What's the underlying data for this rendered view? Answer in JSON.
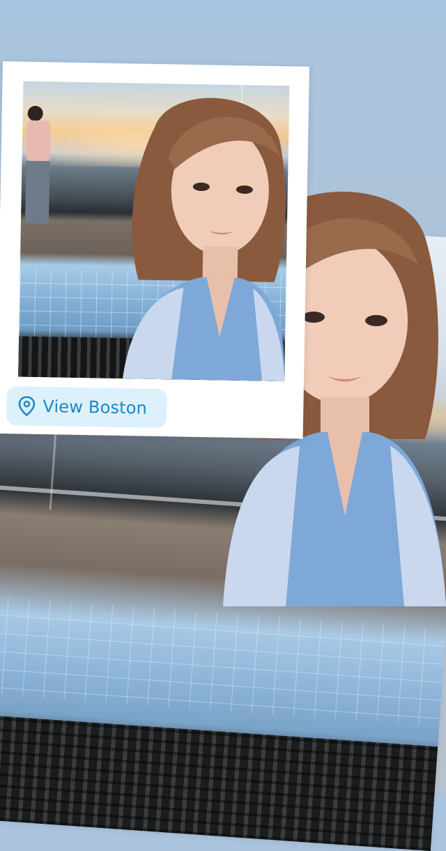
{
  "story": {
    "location_sticker": {
      "label": "View Boston",
      "icon": "location-pin-icon",
      "color": "#1f86c5",
      "background": "#dcf1fb"
    },
    "background_gradient": [
      "#a9c4de",
      "#b8c1cc"
    ]
  }
}
